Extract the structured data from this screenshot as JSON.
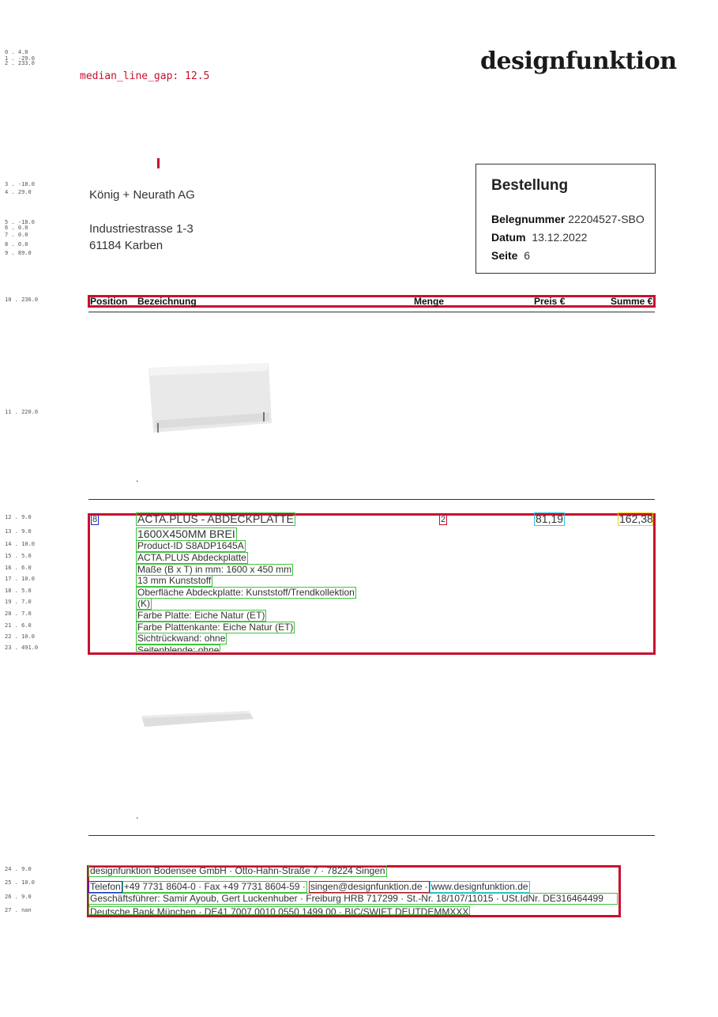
{
  "debug": {
    "median_label": "median_line_gap: 12.5",
    "lines": [
      "0 . 4.0",
      "1 . -29.0",
      "2 . 233.0",
      "3 . -18.0",
      "4 . 29.0",
      "5 . -18.0",
      "6 . 0.0",
      "7 . 0.0",
      "8 . 0.0",
      "9 . 89.0",
      "10 . 236.0",
      "11 . 220.0",
      "12 . 9.0",
      "13 . 9.0",
      "14 . 10.0",
      "15 . 5.0",
      "16 . 6.0",
      "17 . 10.0",
      "18 . 5.0",
      "19 . 7.0",
      "20 . 7.0",
      "21 . 6.0",
      "22 . 10.0",
      "23 . 491.0",
      "24 . 9.0",
      "25 . 10.0",
      "26 . 9.0",
      "27 . nan"
    ]
  },
  "logo": "designfunktion",
  "recipient": {
    "name": "König + Neurath AG",
    "street": "Industriestrasse 1-3",
    "city": "61184 Karben"
  },
  "order_box": {
    "title": "Bestellung",
    "belegnummer_label": "Belegnummer",
    "belegnummer": "22204527-SBO",
    "datum_label": "Datum",
    "datum": "13.12.2022",
    "seite_label": "Seite",
    "seite": "6"
  },
  "table_header": {
    "position": "Position",
    "bezeichnung": "Bezeichnung",
    "menge": "Menge",
    "preis": "Preis €",
    "summe": "Summe €"
  },
  "item": {
    "position": "8",
    "title_line1": "ACTA.PLUS - ABDECKPLATTE",
    "title_line2": "1600X450MM BREI",
    "menge": "2",
    "preis": "81,19",
    "summe": "162,38",
    "details": [
      "Product-ID S8ADP1645A",
      "ACTA.PLUS Abdeckplatte",
      "Maße (B x T) in mm:  1600 x 450 mm",
      "13 mm Kunststoff",
      "Oberfläche Abdeckplatte: Kunststoff/Trendkollektion",
      "(K)",
      "Farbe Platte: Eiche Natur (ET)",
      "Farbe Plattenkante: Eiche Natur (ET)",
      "Sichtrückwand: ohne",
      "Seitenblende: ohne"
    ]
  },
  "dots": [
    ".",
    "."
  ],
  "footer": {
    "line1": "designfunktion Bodensee GmbH · Otto-Hahn-Straße 7 · 78224 Singen",
    "telefon": "Telefon ",
    "phones": "+49 7731 8604-0 · Fax +49 7731 8604-59 · ",
    "email": "singen@designfunktion.de · ",
    "web": "www.designfunktion.de",
    "line3": "Geschäftsführer: Samir Ayoub, Gert Luckenhuber · Freiburg HRB 717299 · St.-Nr. 18/107/11015 · USt.IdNr. DE316464499",
    "line4": "Deutsche Bank München · DE41 7007 0010 0550 1499 00 · BIC/SWIFT DEUTDEMMXXX"
  },
  "colors": {
    "accent_red": "#c8102e",
    "box_green": "#3ec43e",
    "box_cyan": "#2ac8e0",
    "box_yellow": "#f2d200",
    "box_blue": "#1a2bd8"
  }
}
